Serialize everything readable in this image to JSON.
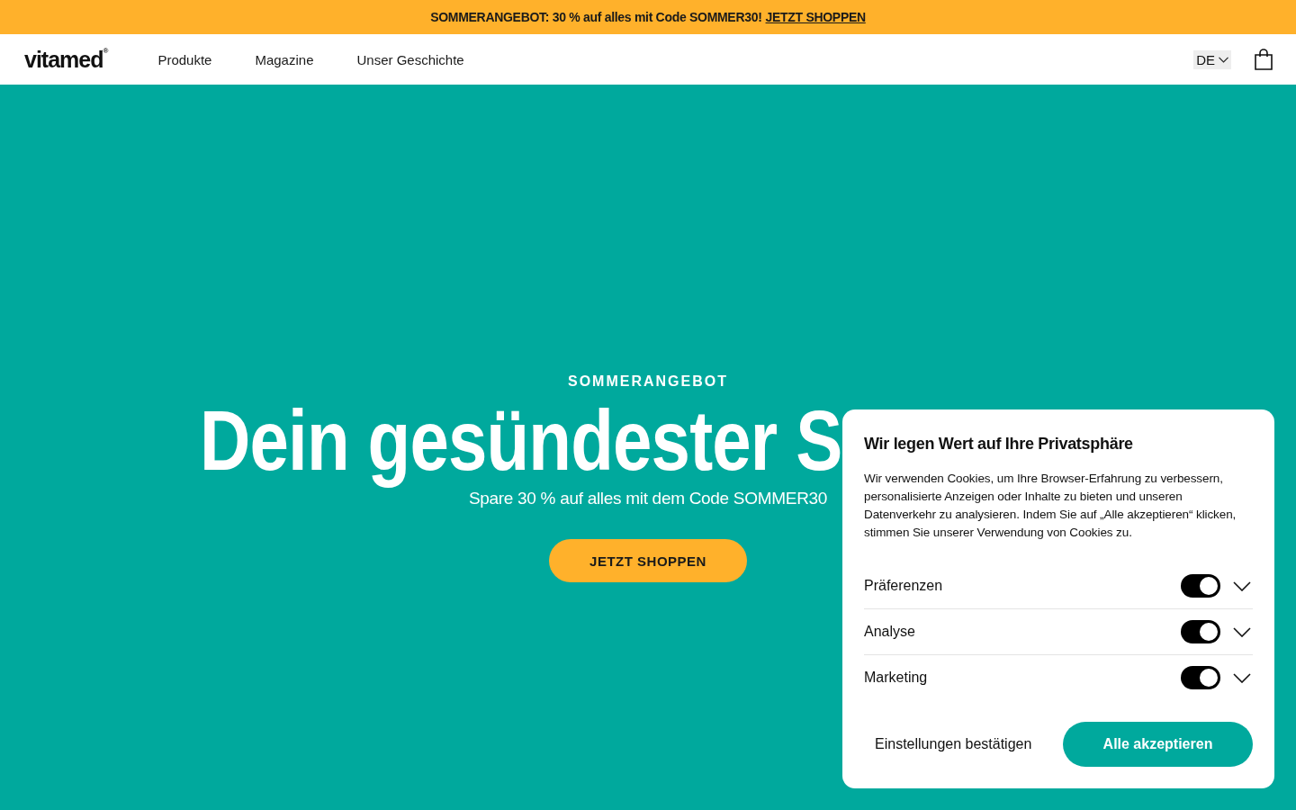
{
  "promo_bar": {
    "text": "SOMMERANGEBOT: 30 % auf alles mit Code SOMMER30!",
    "link": "JETZT SHOPPEN"
  },
  "header": {
    "logo": "vitamed$^{®}$",
    "nav": [
      "Produkte",
      "Magazine",
      "Unser Geschichte"
    ],
    "language": "DE"
  },
  "hero": {
    "eyebrow": "SOMMERANGEBOT",
    "heading": "Dein gesündester S",
    "subtitle": "Spare 30 % auf alles mit dem Code SOMMER30",
    "button": "JETZT SHOPPEN"
  },
  "cookie_dialog": {
    "title": "Wir legen Wert auf Ihre Privatsphäre",
    "text": "Wir verwenden Cookies, um Ihre Browser-Erfahrung zu verbessern, personalisierte Anzeigen oder Inhalte zu bieten und unseren Datenverkehr zu analysieren. Indem Sie auf „Alle akzeptieren“ klicken, stimmen Sie unserer Verwendung von Cookies zu.",
    "categories": [
      {
        "label": "Präferenzen",
        "on": true,
        "expanded": false
      },
      {
        "label": "Analyse",
        "on": true,
        "expanded": false
      },
      {
        "label": "Marketing",
        "on": true,
        "expanded": false
      }
    ],
    "buttons": [
      {
        "kind": "text",
        "label": "Einstellungen bestätigen"
      },
      {
        "kind": "primary",
        "label": "Alle akzeptieren"
      }
    ]
  }
}
